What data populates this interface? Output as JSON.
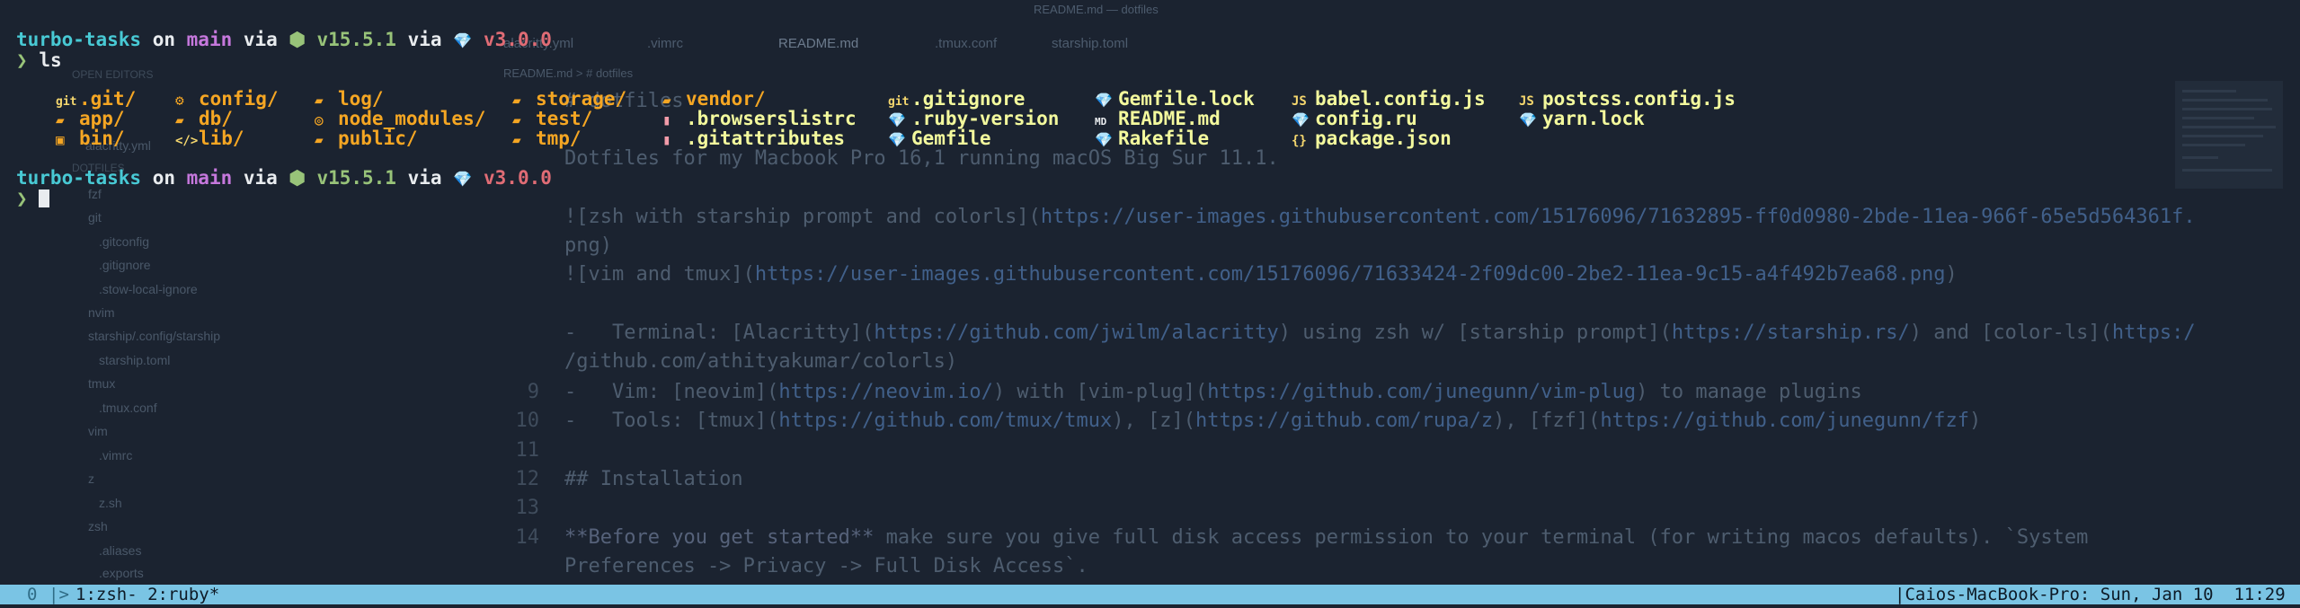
{
  "background_editor": {
    "window_title": "README.md — dotfiles",
    "tabs": [
      {
        "label": "alacritty.yml",
        "active": false
      },
      {
        "label": ".vimrc",
        "active": false
      },
      {
        "label": "README.md",
        "active": true
      },
      {
        "label": ".tmux.conf",
        "active": false
      },
      {
        "label": "starship.toml",
        "active": false
      }
    ],
    "breadcrumb": "README.md > # dotfiles",
    "sidebar": [
      "OPEN EDITORS",
      "alacritty.yml",
      "DOTFILES",
      "fzf",
      "git",
      ".gitconfig",
      ".gitignore",
      ".stow-local-ignore",
      "nvim",
      "starship/.config/starship",
      "starship.toml",
      "tmux",
      ".tmux.conf",
      "vim",
      ".vimrc",
      "z",
      "z.sh",
      "zsh",
      ".aliases",
      ".exports"
    ],
    "line_numbers": [
      "9",
      "10",
      "11",
      "12",
      "13",
      "14"
    ],
    "code": {
      "heading": "# dotfiles",
      "desc": "Dotfiles for my Macbook Pro 16,1 running macOS Big Sur 11.1.",
      "img1_a": "![zsh with starship prompt and colorls](",
      "img1_b": "https://user-images.githubusercontent.com/15176096/71632895-ff0d0980-2bde-11ea-966f-65e5d564361f.",
      "img1_c": "png)",
      "img2_a": "![vim and tmux](",
      "img2_b": "https://user-images.githubusercontent.com/15176096/71633424-2f09dc00-2be2-11ea-9c15-a4f492b7ea68.png",
      "img2_c": ")",
      "term_a": "-   Terminal: [Alacritty](",
      "term_b": "https://github.com/jwilm/alacritty",
      "term_c": ") using zsh w/ [starship prompt](",
      "term_d": "https://starship.rs/",
      "term_e": ") and [color-ls](",
      "term_f": "https:/",
      "term2": "/github.com/athityakumar/colorls)",
      "vim_a": "-   Vim: [neovim](",
      "vim_b": "https://neovim.io/",
      "vim_c": ") with [vim-plug](",
      "vim_d": "https://github.com/junegunn/vim-plug",
      "vim_e": ") to manage plugins",
      "tools_a": "-   Tools: [tmux](",
      "tools_b": "https://github.com/tmux/tmux",
      "tools_c": "), [z](",
      "tools_d": "https://github.com/rupa/z",
      "tools_e": "), [fzf](",
      "tools_f": "https://github.com/junegunn/fzf",
      "tools_g": ")",
      "install": "## Installation",
      "before_bold": "**Before you get started**",
      "before_rest": " make sure you give full disk access permission to your terminal (for writing macos defaults). `System",
      "before2": "Preferences -> Privacy -> Full Disk Access`."
    }
  },
  "terminal": {
    "prompt": {
      "dir": "turbo-tasks",
      "on": " on ",
      "branch_icon": "",
      "branch": "main",
      "via1": " via ",
      "node_icon": "⬢",
      "node_version": "v15.5.1",
      "via2": " via ",
      "ruby_icon": "💎",
      "ruby_version": "v3.0.0",
      "char": "❯"
    },
    "command": "ls",
    "ls_columns": [
      [
        {
          "icon": "git",
          "icon_class": "git",
          "name": ".git/",
          "kind": "dir"
        },
        {
          "icon": "▰",
          "icon_class": "folder",
          "name": "app/",
          "kind": "dir"
        },
        {
          "icon": "▣",
          "icon_class": "folder",
          "name": "bin/",
          "kind": "dir"
        }
      ],
      [
        {
          "icon": "⚙",
          "icon_class": "folder",
          "name": "config/",
          "kind": "dir"
        },
        {
          "icon": "▰",
          "icon_class": "folder",
          "name": "db/",
          "kind": "dir"
        },
        {
          "icon": "</>",
          "icon_class": "js",
          "name": "lib/",
          "kind": "dir"
        }
      ],
      [
        {
          "icon": "▰",
          "icon_class": "folder",
          "name": "log/",
          "kind": "dir"
        },
        {
          "icon": "◎",
          "icon_class": "folder",
          "name": "node_modules/",
          "kind": "dir"
        },
        {
          "icon": "▰",
          "icon_class": "folder",
          "name": "public/",
          "kind": "dir"
        }
      ],
      [
        {
          "icon": "▰",
          "icon_class": "folder",
          "name": "storage/",
          "kind": "dir"
        },
        {
          "icon": "▰",
          "icon_class": "folder",
          "name": "test/",
          "kind": "dir"
        },
        {
          "icon": "▰",
          "icon_class": "folder",
          "name": "tmp/",
          "kind": "dir"
        }
      ],
      [
        {
          "icon": "▰",
          "icon_class": "folder",
          "name": "vendor/",
          "kind": "dir"
        },
        {
          "icon": "▮",
          "icon_class": "doc",
          "name": ".browserslistrc",
          "kind": "file"
        },
        {
          "icon": "▮",
          "icon_class": "doc",
          "name": ".gitattributes",
          "kind": "file"
        }
      ],
      [
        {
          "icon": "git",
          "icon_class": "git",
          "name": ".gitignore",
          "kind": "file"
        },
        {
          "icon": "💎",
          "icon_class": "gem",
          "name": ".ruby-version",
          "kind": "file"
        },
        {
          "icon": "💎",
          "icon_class": "gem",
          "name": "Gemfile",
          "kind": "file"
        }
      ],
      [
        {
          "icon": "💎",
          "icon_class": "gem",
          "name": "Gemfile.lock",
          "kind": "file"
        },
        {
          "icon": "MD",
          "icon_class": "md",
          "name": "README.md",
          "kind": "file"
        },
        {
          "icon": "💎",
          "icon_class": "gem",
          "name": "Rakefile",
          "kind": "file"
        }
      ],
      [
        {
          "icon": "JS",
          "icon_class": "js",
          "name": "babel.config.js",
          "kind": "file"
        },
        {
          "icon": "💎",
          "icon_class": "gem",
          "name": "config.ru",
          "kind": "file"
        },
        {
          "icon": "{}",
          "icon_class": "js",
          "name": "package.json",
          "kind": "file"
        }
      ],
      [
        {
          "icon": "JS",
          "icon_class": "js",
          "name": "postcss.config.js",
          "kind": "file"
        },
        {
          "icon": "💎",
          "icon_class": "gem",
          "name": "yarn.lock",
          "kind": "file"
        }
      ]
    ]
  },
  "status_bar": {
    "session": "0",
    "separator": "|>",
    "windows": "1:zsh- 2:ruby*",
    "right": "|Caios-MacBook-Pro: Sun, Jan 10  11:29 |"
  },
  "colors": {
    "background": "#1b2330",
    "status_bar": "#7ac4e4",
    "directory": "#48c9d4",
    "branch": "#c678dd",
    "node": "#98c379",
    "ruby": "#e06c75",
    "ls_dir": "#f5a623",
    "ls_file": "#f3f99d"
  }
}
